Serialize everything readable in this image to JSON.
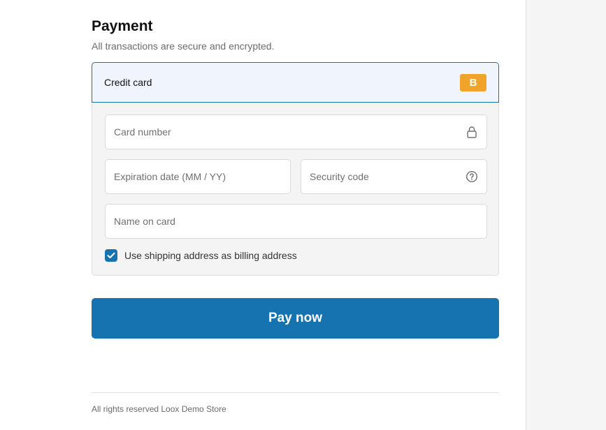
{
  "payment": {
    "title": "Payment",
    "subtitle": "All transactions are secure and encrypted."
  },
  "method": {
    "label": "Credit card",
    "badge": "B",
    "badge_color": "#f0a429"
  },
  "fields": {
    "card_number": {
      "placeholder": "Card number",
      "icon": "lock-icon"
    },
    "expiration": {
      "placeholder": "Expiration date (MM / YY)"
    },
    "security_code": {
      "placeholder": "Security code",
      "icon": "help-circle-icon"
    },
    "name_on_card": {
      "placeholder": "Name on card"
    }
  },
  "billing": {
    "checked": true,
    "label": "Use shipping address as billing address"
  },
  "pay_button": {
    "label": "Pay now"
  },
  "footer": {
    "text": "All rights reserved Loox Demo Store"
  },
  "colors": {
    "accent": "#1773b0",
    "header_bg": "#f0f5fd",
    "body_bg": "#f4f4f4",
    "side_panel": "#f5f5f5"
  }
}
